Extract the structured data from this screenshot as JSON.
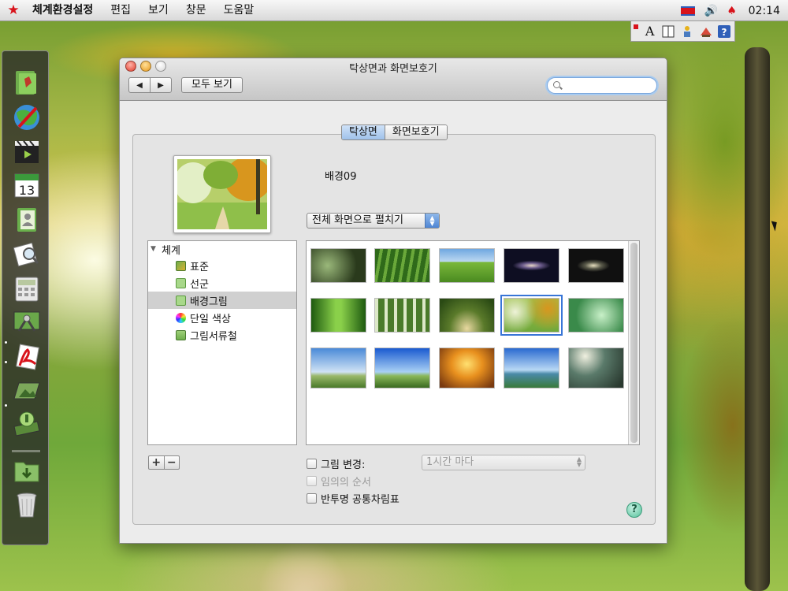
{
  "menubar": {
    "app_menu": "체계환경설정",
    "items": [
      "편집",
      "보기",
      "창문",
      "도움말"
    ],
    "clock": "02:14"
  },
  "ime_toolbar": {
    "text_icon": "A",
    "icons": [
      "text-input-icon",
      "layout-icon",
      "tool-icon",
      "dictionary-icon",
      "help-icon"
    ]
  },
  "dock": {
    "icons": [
      "notes-icon",
      "globe-icon",
      "film-icon",
      "calendar-icon",
      "contacts-icon",
      "preview-icon",
      "calculator-icon",
      "system-tools-icon",
      "pdf-icon",
      "image-viewer-icon",
      "settings-icon",
      "downloads-folder-icon",
      "trash-icon"
    ],
    "calendar_day": "13"
  },
  "window": {
    "title": "탁상면과 화면보호기",
    "show_all": "모두 보기",
    "search_placeholder": ""
  },
  "tabs": {
    "desktop": "탁상면",
    "screensaver": "화면보호기"
  },
  "current": {
    "background_name": "배경09",
    "fit_option": "전체 화면으로 펼치기"
  },
  "source_list": {
    "group": "체계",
    "items": [
      {
        "label": "표준",
        "icon": "picture-icon"
      },
      {
        "label": "선군",
        "icon": "folder-icon"
      },
      {
        "label": "배경그림",
        "icon": "folder-icon",
        "selected": true
      },
      {
        "label": "단일 색상",
        "icon": "color-wheel-icon"
      },
      {
        "label": "그림서류철",
        "icon": "pictures-folder-icon"
      }
    ]
  },
  "thumbnails": {
    "selected_index": 8,
    "count": 15
  },
  "bottom": {
    "add": "+",
    "remove": "−",
    "change_picture": "그림 변경:",
    "interval": "1시간 마다",
    "random_order": "임의의 순서",
    "translucent_menubar": "반투명 공통차림표",
    "help": "?"
  },
  "colors": {
    "accent": "#3875d7",
    "flag_red": "#d8131b",
    "selection_gray": "#d0d0d0"
  }
}
